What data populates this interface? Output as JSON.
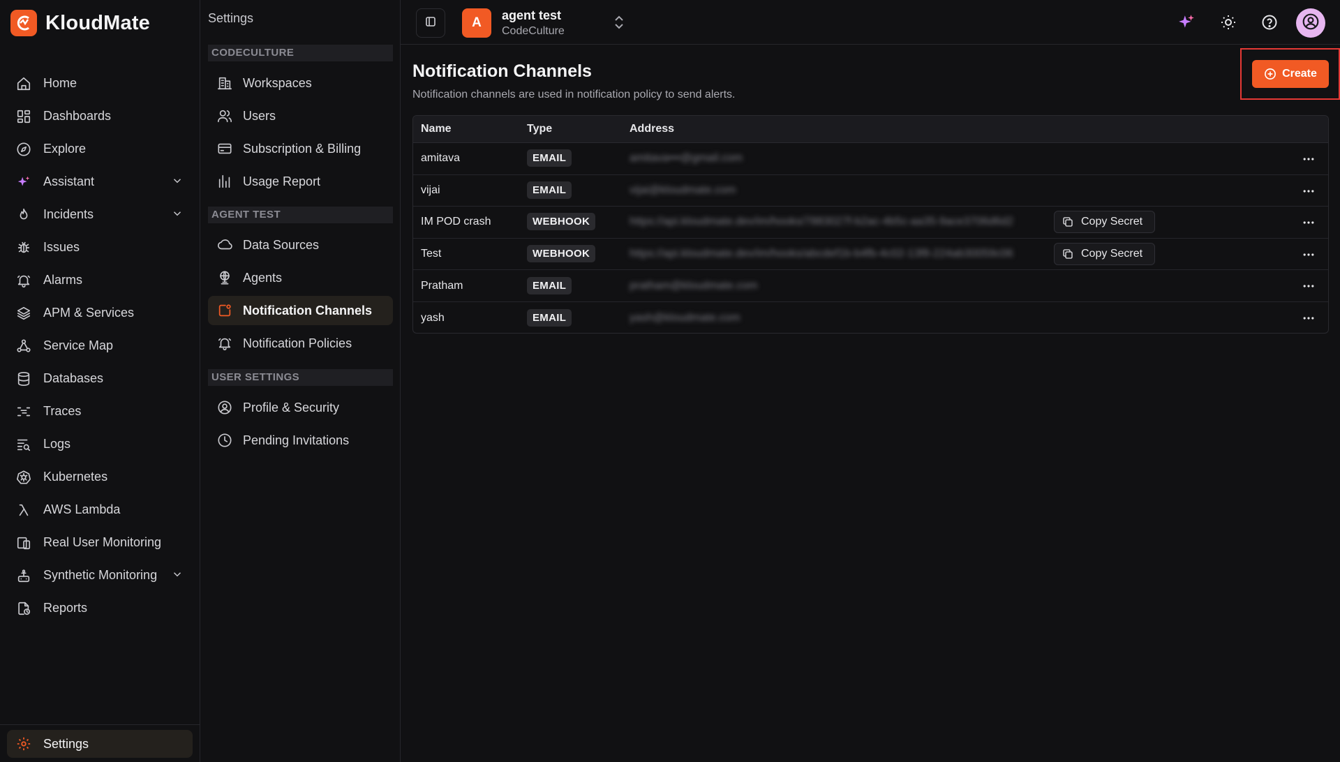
{
  "brand": {
    "name": "KloudMate",
    "accent": "#f15a24"
  },
  "nav": {
    "items": [
      {
        "label": "Home",
        "icon": "home-icon",
        "expandable": false
      },
      {
        "label": "Dashboards",
        "icon": "dashboard-icon",
        "expandable": false
      },
      {
        "label": "Explore",
        "icon": "compass-icon",
        "expandable": false
      },
      {
        "label": "Assistant",
        "icon": "sparkle-icon",
        "expandable": true
      },
      {
        "label": "Incidents",
        "icon": "flame-icon",
        "expandable": true
      },
      {
        "label": "Issues",
        "icon": "bug-icon",
        "expandable": false
      },
      {
        "label": "Alarms",
        "icon": "bell-icon",
        "expandable": false
      },
      {
        "label": "APM & Services",
        "icon": "layers-icon",
        "expandable": false
      },
      {
        "label": "Service Map",
        "icon": "network-icon",
        "expandable": false
      },
      {
        "label": "Databases",
        "icon": "database-icon",
        "expandable": false
      },
      {
        "label": "Traces",
        "icon": "traces-icon",
        "expandable": false
      },
      {
        "label": "Logs",
        "icon": "logs-icon",
        "expandable": false
      },
      {
        "label": "Kubernetes",
        "icon": "kubernetes-icon",
        "expandable": false
      },
      {
        "label": "AWS Lambda",
        "icon": "lambda-icon",
        "expandable": false
      },
      {
        "label": "Real User Monitoring",
        "icon": "rum-icon",
        "expandable": false
      },
      {
        "label": "Synthetic Monitoring",
        "icon": "robot-icon",
        "expandable": true
      },
      {
        "label": "Reports",
        "icon": "report-icon",
        "expandable": false
      }
    ],
    "settings_label": "Settings"
  },
  "settings": {
    "title": "Settings",
    "sections": [
      {
        "heading": "CODECULTURE",
        "items": [
          "Workspaces",
          "Users",
          "Subscription & Billing",
          "Usage Report"
        ]
      },
      {
        "heading": "AGENT TEST",
        "items": [
          "Data Sources",
          "Agents",
          "Notification Channels",
          "Notification Policies"
        ]
      },
      {
        "heading": "USER SETTINGS",
        "items": [
          "Profile & Security",
          "Pending Invitations"
        ]
      }
    ],
    "active": "Notification Channels"
  },
  "topbar": {
    "workspace_initial": "A",
    "workspace_name": "agent test",
    "org_name": "CodeCulture"
  },
  "page": {
    "title": "Notification Channels",
    "description": "Notification channels are used in notification policy to send alerts.",
    "create_label": "Create",
    "columns": [
      "Name",
      "Type",
      "Address"
    ],
    "copy_secret_label": "Copy Secret",
    "rows": [
      {
        "name": "amitava",
        "type": "EMAIL",
        "address": "amitava•••@gmail.com",
        "has_secret": false
      },
      {
        "name": "vijai",
        "type": "EMAIL",
        "address": "vijai@kloudmate.com",
        "has_secret": false
      },
      {
        "name": "IM POD crash",
        "type": "WEBHOOK",
        "address": "https://api.kloudmate.dev/im/hooks/7883027f-b2ac-4b5c-aa35-9ace3706d6d2",
        "has_secret": true
      },
      {
        "name": "Test",
        "type": "WEBHOOK",
        "address": "https://api.kloudmate.dev/im/hooks/abcdef1b-b4fb-4c02-13f8-224ab30059c06",
        "has_secret": true
      },
      {
        "name": "Pratham",
        "type": "EMAIL",
        "address": "pratham@kloudmate.com",
        "has_secret": false
      },
      {
        "name": "yash",
        "type": "EMAIL",
        "address": "yash@kloudmate.com",
        "has_secret": false
      }
    ]
  }
}
